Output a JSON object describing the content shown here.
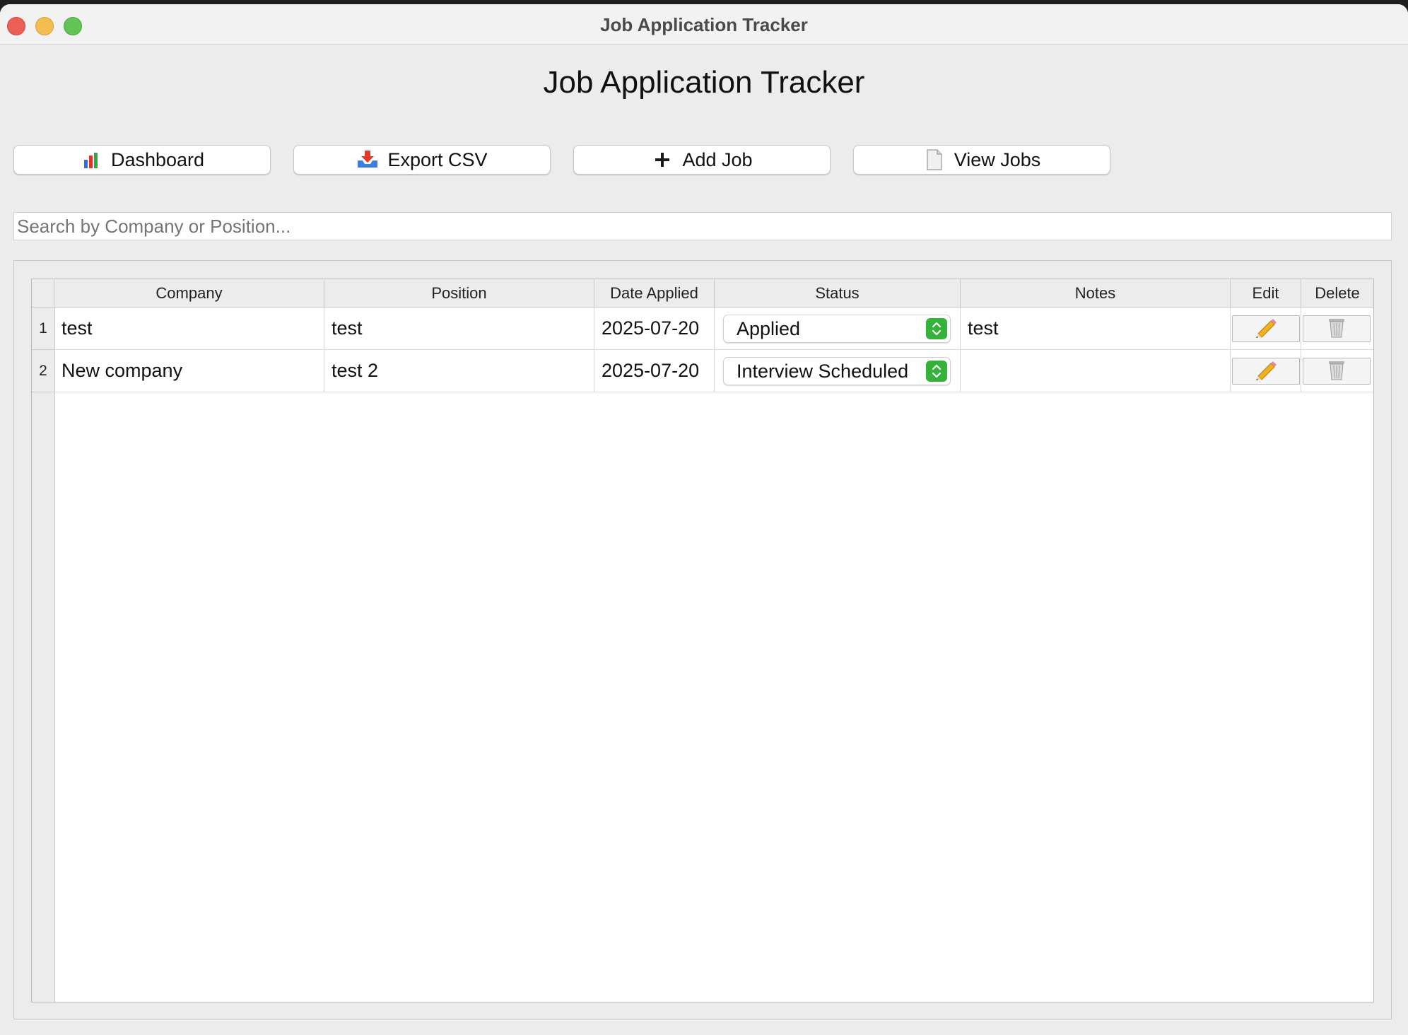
{
  "window": {
    "title": "Job Application Tracker"
  },
  "app": {
    "title": "Job Application Tracker"
  },
  "toolbar": {
    "dashboard_label": "Dashboard",
    "export_label": "Export CSV",
    "add_label": "Add Job",
    "view_label": "View Jobs"
  },
  "search": {
    "placeholder": "Search by Company or Position...",
    "value": ""
  },
  "table": {
    "columns": [
      "Company",
      "Position",
      "Date Applied",
      "Status",
      "Notes",
      "Edit",
      "Delete"
    ],
    "rows": [
      {
        "num": "1",
        "company": "test",
        "position": "test",
        "date": "2025-07-20",
        "status": "Applied",
        "notes": "test"
      },
      {
        "num": "2",
        "company": "New company",
        "position": "test 2",
        "date": "2025-07-20",
        "status": "Interview Scheduled",
        "notes": ""
      }
    ]
  },
  "icons": {
    "dashboard": "bar-chart-icon",
    "export": "inbox-tray-icon",
    "add": "plus-icon",
    "view": "document-icon",
    "edit": "pencil-icon",
    "delete": "trash-icon",
    "status_stepper": "chevron-up-down-icon"
  },
  "colors": {
    "accent_green": "#35b23a"
  }
}
